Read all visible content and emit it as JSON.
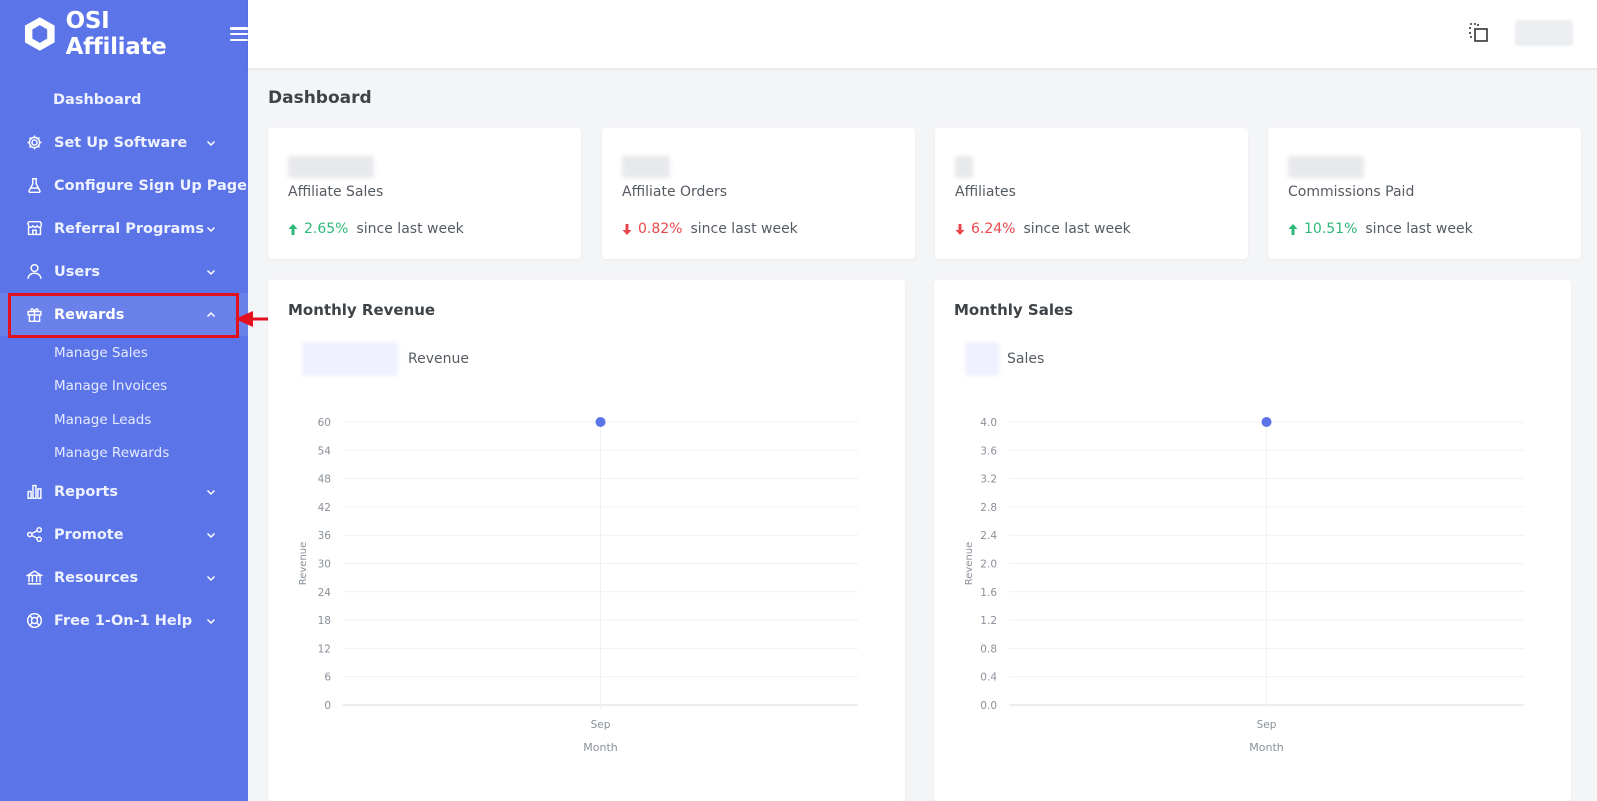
{
  "app": {
    "brand": "OSI Affiliate"
  },
  "sidebar": {
    "items": [
      {
        "label": "Dashboard",
        "icon": "none",
        "chevron": false
      },
      {
        "label": "Set Up Software",
        "icon": "gear-icon",
        "chevron": true
      },
      {
        "label": "Configure Sign Up Page",
        "icon": "flask-icon",
        "chevron": false
      },
      {
        "label": "Referral Programs",
        "icon": "store-icon",
        "chevron": true
      },
      {
        "label": "Users",
        "icon": "user-icon",
        "chevron": true
      },
      {
        "label": "Rewards",
        "icon": "gift-icon",
        "chevron": true,
        "expanded": true
      },
      {
        "label": "Reports",
        "icon": "bar-chart-icon",
        "chevron": true
      },
      {
        "label": "Promote",
        "icon": "share-icon",
        "chevron": true
      },
      {
        "label": "Resources",
        "icon": "bank-icon",
        "chevron": true
      },
      {
        "label": "Free 1-On-1 Help",
        "icon": "lifebuoy-icon",
        "chevron": true
      }
    ],
    "rewards_sub": [
      "Manage Sales",
      "Manage Invoices",
      "Manage Leads",
      "Manage Rewards"
    ]
  },
  "page": {
    "title": "Dashboard"
  },
  "stats": [
    {
      "label": "Affiliate Sales",
      "change": "2.65%",
      "direction": "up",
      "since": "since last week"
    },
    {
      "label": "Affiliate Orders",
      "change": "0.82%",
      "direction": "down",
      "since": "since last week"
    },
    {
      "label": "Affiliates",
      "change": "6.24%",
      "direction": "down",
      "since": "since last week"
    },
    {
      "label": "Commissions Paid",
      "change": "10.51%",
      "direction": "up",
      "since": "since last week"
    }
  ],
  "colors": {
    "sidebar": "#5b74e8",
    "accent": "#5b74e8",
    "up": "#2fb877",
    "down": "#e8484c",
    "annotation": "#e3101d"
  },
  "chart_data": [
    {
      "type": "scatter",
      "title": "Monthly Revenue",
      "legend": "Revenue",
      "xlabel": "Month",
      "ylabel": "Revenue",
      "categories": [
        "Sep"
      ],
      "values": [
        60
      ],
      "ylim": [
        0,
        60
      ],
      "yticks": [
        "60",
        "54",
        "48",
        "42",
        "36",
        "30",
        "24",
        "18",
        "12",
        "6",
        "0"
      ],
      "grid": true
    },
    {
      "type": "scatter",
      "title": "Monthly Sales",
      "legend": "Sales",
      "xlabel": "Month",
      "ylabel": "Revenue",
      "categories": [
        "Sep"
      ],
      "values": [
        4.0
      ],
      "ylim": [
        0,
        4.0
      ],
      "yticks": [
        "4.0",
        "3.6",
        "3.2",
        "2.8",
        "2.4",
        "2.0",
        "1.6",
        "1.2",
        "0.8",
        "0.4",
        "0.0"
      ],
      "grid": true
    }
  ]
}
